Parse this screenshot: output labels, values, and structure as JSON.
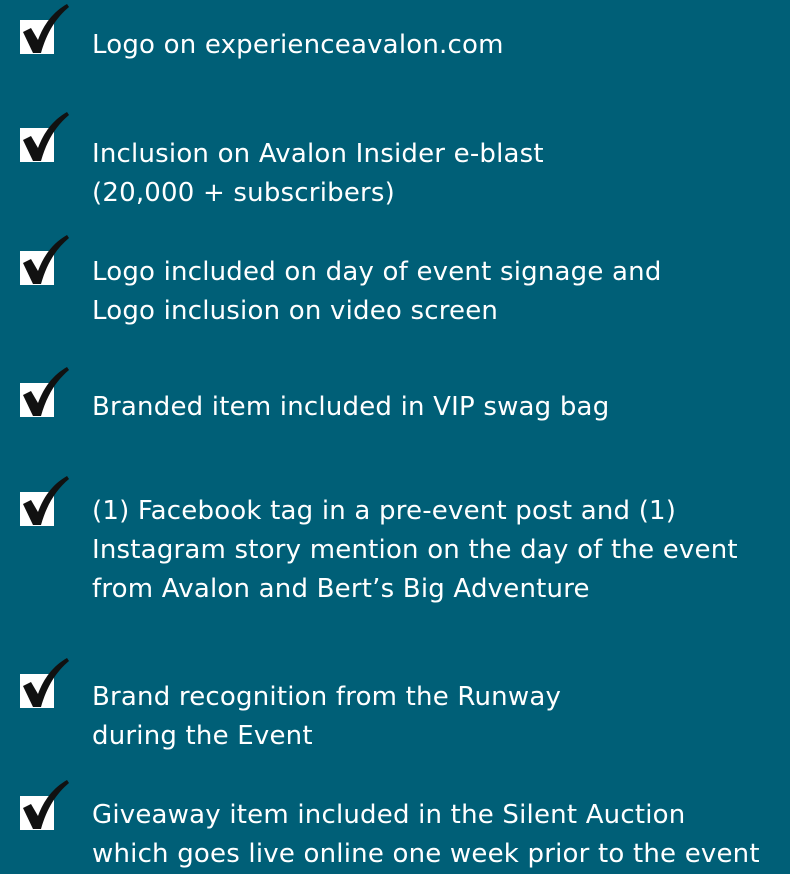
{
  "colors": {
    "background": "#005f77",
    "text": "#ffffff",
    "checkmark": "#111111"
  },
  "benefits": [
    {
      "icon": "checkbox-checked-icon",
      "lines": [
        "Logo on experienceavalon.com"
      ]
    },
    {
      "icon": "checkbox-checked-icon",
      "lines": [
        "Inclusion on Avalon Insider e-blast",
        "(20,000 + subscribers)"
      ]
    },
    {
      "icon": "checkbox-checked-icon",
      "lines": [
        "Logo included on day of event signage and",
        "Logo inclusion on video screen"
      ]
    },
    {
      "icon": "checkbox-checked-icon",
      "lines": [
        "Branded item included in VIP swag bag"
      ]
    },
    {
      "icon": "checkbox-checked-icon",
      "lines": [
        "(1) Facebook tag in a pre-event post and (1)",
        "Instagram story mention on the day of the event",
        "from Avalon and Bert’s Big Adventure"
      ]
    },
    {
      "icon": "checkbox-checked-icon",
      "lines": [
        "Brand recognition from the Runway",
        "during the Event"
      ]
    },
    {
      "icon": "checkbox-checked-icon",
      "lines": [
        "Giveaway item included in the Silent Auction",
        "which goes live online one week prior to the event"
      ]
    }
  ]
}
